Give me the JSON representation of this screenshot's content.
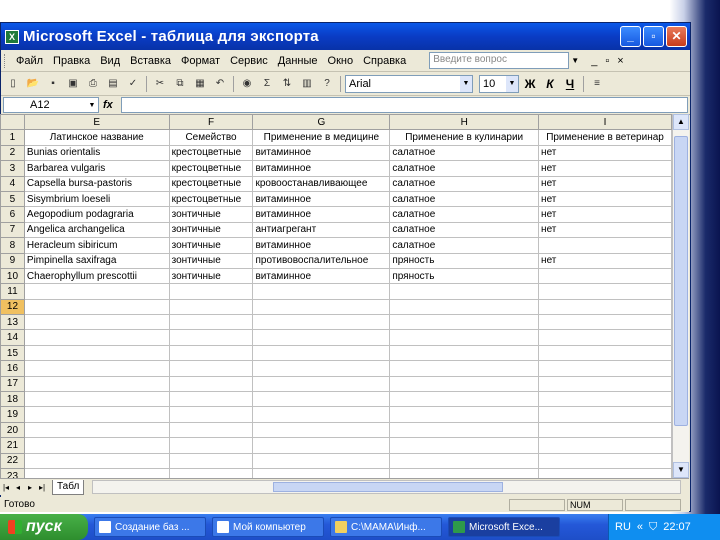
{
  "window": {
    "title": "Microsoft Excel - таблица для экспорта",
    "btn_min": "_",
    "btn_max": "▫",
    "btn_close": "✕"
  },
  "menu": {
    "items": [
      "Файл",
      "Правка",
      "Вид",
      "Вставка",
      "Формат",
      "Сервис",
      "Данные",
      "Окно",
      "Справка"
    ],
    "ask_placeholder": "Введите вопрос",
    "controls": [
      "_",
      "▫",
      "×"
    ]
  },
  "toolbar": {
    "font_name": "Arial",
    "font_size": "10",
    "bold": "Ж",
    "italic": "К",
    "underline": "Ч",
    "sum": "Σ",
    "zoom_icon": "zoom-icon"
  },
  "formula": {
    "cell_ref": "A12",
    "fx": "fx",
    "value": ""
  },
  "grid": {
    "columns": [
      "E",
      "F",
      "G",
      "H",
      "I"
    ],
    "headers": [
      "Латинское название",
      "Семейство",
      "Применение в медицине",
      "Применение в кулинарии",
      "Применение в ветеринар"
    ],
    "rows": [
      [
        "Bunias orientalis",
        "крестоцветные",
        "витаминное",
        "салатное",
        "нет"
      ],
      [
        "Barbarea vulgaris",
        "крестоцветные",
        "витаминное",
        "салатное",
        "нет"
      ],
      [
        "Capsella bursa-pastoris",
        "крестоцветные",
        "кровоостанавливающее",
        "салатное",
        "нет"
      ],
      [
        "Sisymbrium loeseli",
        "крестоцветные",
        "витаминное",
        "салатное",
        "нет"
      ],
      [
        "Aegopodium podagraria",
        "зонтичные",
        "витаминное",
        "салатное",
        "нет"
      ],
      [
        "Angelica archangelica",
        "зонтичные",
        "антиагрегант",
        "салатное",
        "нет"
      ],
      [
        "Heracleum sibiricum",
        "зонтичные",
        "витаминное",
        "салатное",
        ""
      ],
      [
        "Pimpinella saxifraga",
        "зонтичные",
        "противовоспалительное",
        "пряность",
        "нет"
      ],
      [
        "Chaerophyllum prescottii",
        "зонтичные",
        "витаминное",
        "пряность",
        ""
      ]
    ],
    "row_numbers": [
      "1",
      "2",
      "3",
      "4",
      "5",
      "6",
      "7",
      "8",
      "9",
      "10",
      "11",
      "12",
      "13",
      "14",
      "15",
      "16",
      "17",
      "18",
      "19",
      "20",
      "21",
      "22",
      "23"
    ],
    "active_row": "12"
  },
  "sheet": {
    "tab_label": "Табл",
    "nav": [
      "|◂",
      "◂",
      "▸",
      "▸|"
    ]
  },
  "status": {
    "left": "Готово",
    "num": "NUM"
  },
  "taskbar": {
    "start": "пуск",
    "tasks": [
      "Создание баз ...",
      "Мой компьютер",
      "C:\\МАМА\\Инф...",
      "Microsoft Exce..."
    ],
    "lang": "RU",
    "time": "22:07"
  }
}
